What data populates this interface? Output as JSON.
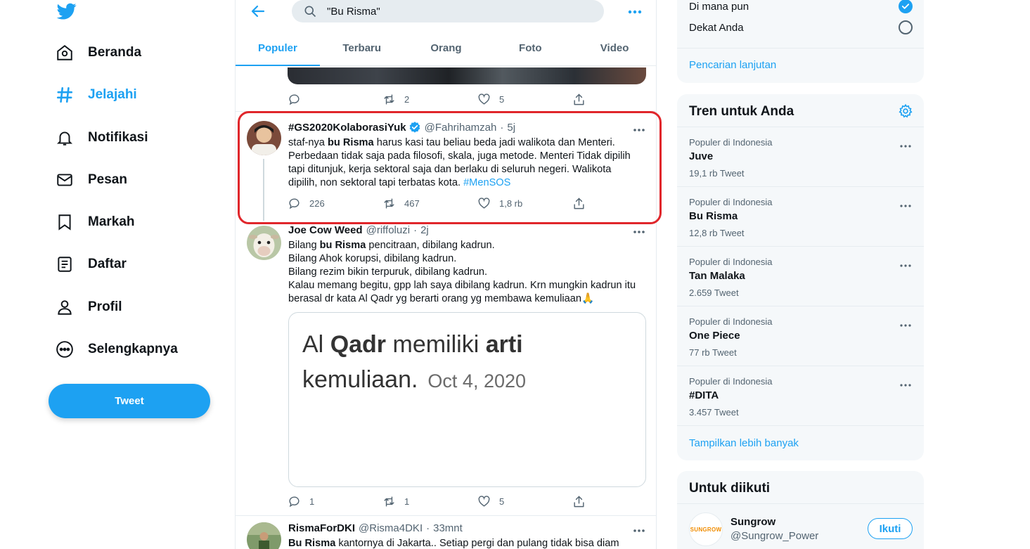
{
  "nav": {
    "items": [
      {
        "label": "Beranda",
        "icon": "home-icon"
      },
      {
        "label": "Jelajahi",
        "icon": "hashtag-icon",
        "active": true
      },
      {
        "label": "Notifikasi",
        "icon": "bell-icon"
      },
      {
        "label": "Pesan",
        "icon": "envelope-icon"
      },
      {
        "label": "Markah",
        "icon": "bookmark-icon"
      },
      {
        "label": "Daftar",
        "icon": "list-icon"
      },
      {
        "label": "Profil",
        "icon": "person-icon"
      },
      {
        "label": "Selengkapnya",
        "icon": "more-circle-icon"
      }
    ],
    "tweet_button": "Tweet"
  },
  "search": {
    "query": "\"Bu Risma\""
  },
  "tabs": [
    "Populer",
    "Terbaru",
    "Orang",
    "Foto",
    "Video"
  ],
  "active_tab": "Populer",
  "top_tweet_actions": {
    "replies": "",
    "retweets": "2",
    "likes": "5"
  },
  "tweets": [
    {
      "name": "#GS2020KolaborasiYuk",
      "verified": true,
      "handle": "@Fahrihamzah",
      "time": "5j",
      "lines": [
        {
          "bold": "",
          "pre": "staf-nya ",
          "b": "bu Risma",
          "post": " harus kasi tau beliau beda jadi walikota dan Menteri."
        },
        {
          "pre": "Perbedaan tidak saja pada filosofi, skala, juga metode. Menteri Tidak dipilih"
        },
        {
          "pre": "tapi ditunjuk, kerja sektoral saja dan berlaku di seluruh negeri. Walikota"
        },
        {
          "pre": "dipilih, non sektoral tapi terbatas kota. ",
          "hashtag": "#MenSOS"
        }
      ],
      "replies": "226",
      "retweets": "467",
      "likes": "1,8 rb"
    },
    {
      "name": "Joe Cow Weed",
      "handle": "@riffoluzi",
      "time": "2j",
      "lines": [
        {
          "pre": "Bilang ",
          "b": "bu Risma",
          "post": " pencitraan, dibilang kadrun."
        },
        {
          "pre": "Bilang Ahok korupsi, dibilang kadrun."
        },
        {
          "pre": "Bilang rezim bikin terpuruk, dibilang kadrun."
        },
        {
          "pre": "Kalau memang begitu, gpp lah saya dibilang kadrun. Krn mungkin kadrun itu"
        },
        {
          "pre": "berasal dr kata Al Qadr yg berarti orang yg membawa kemuliaan🙏"
        }
      ],
      "card": {
        "w1": "Al ",
        "b1": "Qadr",
        "w2": " memiliki ",
        "b2": "arti",
        "w3": "kemuliaan.",
        "date": "Oct 4, 2020"
      },
      "replies": "1",
      "retweets": "1",
      "likes": "5"
    },
    {
      "name": "RismaForDKI",
      "handle": "@Risma4DKI",
      "time": "33mnt",
      "lines": [
        {
          "b": "Bu Risma",
          "post": " kantornya di Jakarta.. Setiap pergi dan pulang tidak bisa diam"
        }
      ]
    }
  ],
  "location": {
    "anywhere": "Di mana pun",
    "nearby": "Dekat Anda",
    "advanced_link": "Pencarian lanjutan"
  },
  "trends": {
    "title": "Tren untuk Anda",
    "items": [
      {
        "context": "Populer di Indonesia",
        "name": "Juve",
        "count": "19,1 rb Tweet"
      },
      {
        "context": "Populer di Indonesia",
        "name": "Bu Risma",
        "count": "12,8 rb Tweet"
      },
      {
        "context": "Populer di Indonesia",
        "name": "Tan Malaka",
        "count": "2.659 Tweet"
      },
      {
        "context": "Populer di Indonesia",
        "name": "One Piece",
        "count": "77 rb Tweet"
      },
      {
        "context": "Populer di Indonesia",
        "name": "#DITA",
        "count": "3.457 Tweet"
      }
    ],
    "show_more": "Tampilkan lebih banyak"
  },
  "who_to_follow": {
    "title": "Untuk diikuti",
    "account": {
      "name": "Sungrow",
      "handle": "@Sungrow_Power",
      "logo_text": "SUNGROW"
    },
    "follow_label": "Ikuti"
  },
  "colors": {
    "accent": "#1da1f2",
    "highlight": "#e0262b"
  }
}
